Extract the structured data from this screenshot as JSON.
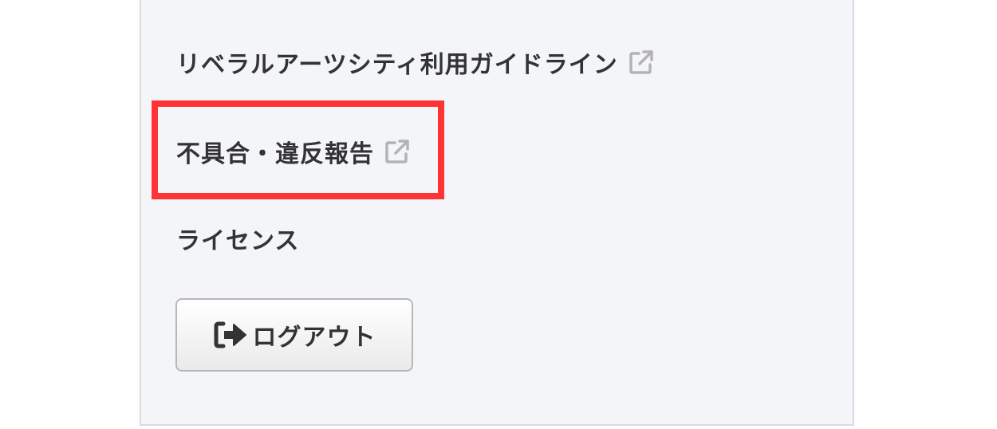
{
  "menu": {
    "guidelines_label": "リベラルアーツシティ利用ガイドライン",
    "report_label": "不具合・違反報告",
    "license_label": "ライセンス"
  },
  "logout": {
    "label": "ログアウト"
  },
  "colors": {
    "panel_background": "#f4f5f9",
    "text": "#333333",
    "external_icon": "#b3b3b3",
    "highlight": "#ff3333"
  },
  "icons": {
    "external_link": "external-link-icon",
    "logout": "sign-out-icon"
  }
}
